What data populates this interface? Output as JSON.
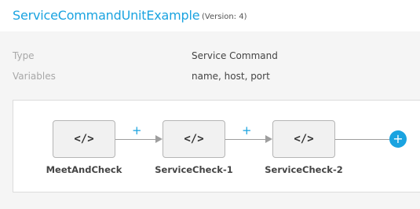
{
  "header": {
    "title": "ServiceCommandUnitExample",
    "version": "(Version: 4)"
  },
  "properties": [
    {
      "label": "Type",
      "value": "Service Command"
    },
    {
      "label": "Variables",
      "value": "name, host, port"
    }
  ],
  "workflow": {
    "nodes": [
      {
        "label": "MeetAndCheck",
        "icon": "code-icon",
        "icon_glyph": "</>"
      },
      {
        "label": "ServiceCheck-1",
        "icon": "code-icon",
        "icon_glyph": "</>"
      },
      {
        "label": "ServiceCheck-2",
        "icon": "code-icon",
        "icon_glyph": "</>"
      }
    ],
    "insert_symbol": "+",
    "add_symbol": "+",
    "accent_color": "#1aa3e0"
  }
}
